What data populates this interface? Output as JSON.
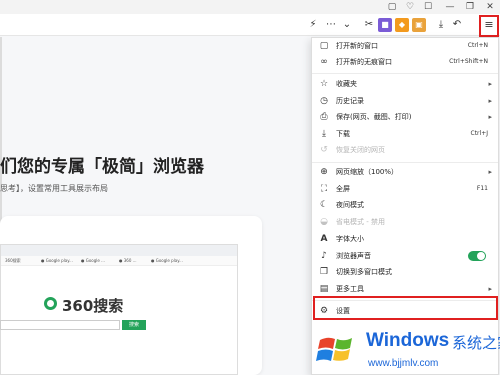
{
  "window": {
    "controls": [
      "▢",
      "♡",
      "☐",
      "—",
      "❐",
      "✕"
    ]
  },
  "toolbar": {
    "icons": [
      "lightning-icon",
      "more-icon",
      "chevron-down-icon",
      "scissors-icon",
      "extension-purple-icon",
      "extension-orange-icon",
      "extension-wallet-icon",
      "download-icon",
      "undo-icon",
      "menu-icon"
    ]
  },
  "page": {
    "hero_title": "们您的专属「极简」浏览器",
    "hero_sub": "思考】，设置常用工具展示布局",
    "preview": {
      "logo_text": "360搜索",
      "search_button": "搜索",
      "bookmarks": [
        "360搜索",
        "● Google play...",
        "● Google ...",
        "● 360 ...",
        "● Google play..."
      ]
    }
  },
  "menu": {
    "items": [
      {
        "label": "打开新的窗口",
        "shortcut": "Ctrl+N",
        "icon": "new-window-icon",
        "enabled": true,
        "arrow": false
      },
      {
        "label": "打开新的无痕窗口",
        "shortcut": "Ctrl+Shift+N",
        "icon": "incognito-icon",
        "enabled": true,
        "arrow": false
      },
      {
        "label": "收藏夹",
        "shortcut": "",
        "icon": "star-icon",
        "enabled": true,
        "arrow": true
      },
      {
        "label": "历史记录",
        "shortcut": "",
        "icon": "history-icon",
        "enabled": true,
        "arrow": true
      },
      {
        "label": "保存(网页、截图、打印)",
        "shortcut": "",
        "icon": "save-icon",
        "enabled": true,
        "arrow": true
      },
      {
        "label": "下载",
        "shortcut": "Ctrl+J",
        "icon": "download-icon",
        "enabled": true,
        "arrow": false
      },
      {
        "label": "恢复关闭的网页",
        "shortcut": "",
        "icon": "restore-icon",
        "enabled": false,
        "arrow": false
      },
      {
        "label": "网页缩放（100%）",
        "shortcut": "",
        "icon": "zoom-icon",
        "enabled": true,
        "arrow": true
      },
      {
        "label": "全屏",
        "shortcut": "F11",
        "icon": "fullscreen-icon",
        "enabled": true,
        "arrow": false
      },
      {
        "label": "夜间模式",
        "shortcut": "",
        "icon": "moon-icon",
        "enabled": true,
        "arrow": false
      },
      {
        "label": "省电模式 - 禁用",
        "shortcut": "",
        "icon": "power-save-icon",
        "enabled": false,
        "arrow": false
      },
      {
        "label": "字体大小",
        "shortcut": "",
        "icon": "font-icon",
        "enabled": true,
        "arrow": false
      },
      {
        "label": "浏览器声音",
        "shortcut": "",
        "icon": "sound-icon",
        "enabled": true,
        "arrow": false,
        "toggle": true
      },
      {
        "label": "切换到多窗口模式",
        "shortcut": "",
        "icon": "multi-window-icon",
        "enabled": true,
        "arrow": false
      },
      {
        "label": "更多工具",
        "shortcut": "",
        "icon": "toolbox-icon",
        "enabled": true,
        "arrow": true
      },
      {
        "label": "设置",
        "shortcut": "",
        "icon": "gear-icon",
        "enabled": true,
        "arrow": false
      }
    ]
  },
  "watermark": {
    "brand": "Windows",
    "brand_cn": "系统之家",
    "url": "www.bjjmlv.com"
  },
  "colors": {
    "highlight_red": "#e02020",
    "toggle_green": "#23a35a",
    "watermark_blue": "#1b66d8"
  }
}
